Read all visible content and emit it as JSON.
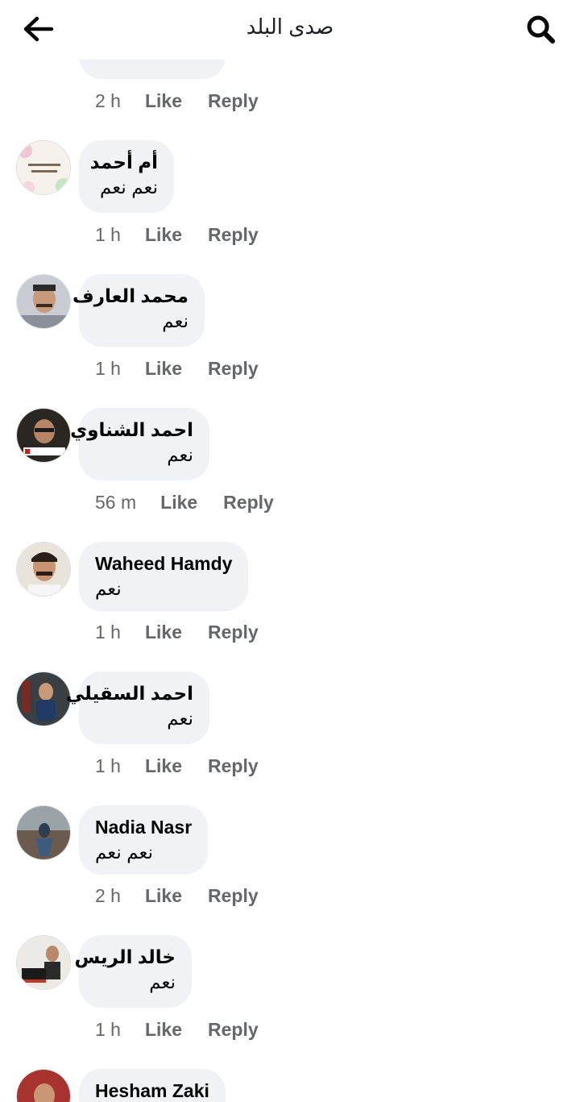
{
  "header": {
    "title": "صدى البلد",
    "back_icon": "arrow-left-icon",
    "search_icon": "search-icon"
  },
  "actions": {
    "like": "Like",
    "reply": "Reply"
  },
  "partial_top": {
    "time": "2 h"
  },
  "comments": [
    {
      "name": "أم أحمد",
      "text": "نعم نعم",
      "time": "1 h"
    },
    {
      "name": "محمد العارف",
      "text": "نعم",
      "time": "1 h"
    },
    {
      "name": "احمد الشناوي",
      "text": "نعم",
      "time": "56 m"
    },
    {
      "name": "Waheed Hamdy",
      "text": "نعم",
      "time": "1 h"
    },
    {
      "name": "احمد السقيلي",
      "text": "نعم",
      "time": "1 h"
    },
    {
      "name": "Nadia Nasr",
      "text": "نعم نعم",
      "time": "2 h"
    },
    {
      "name": "خالد الريس",
      "text": "نعم",
      "time": "1 h"
    },
    {
      "name": "Hesham Zaki",
      "text": "",
      "time": ""
    }
  ],
  "colors": {
    "bubble": "#f0f2f5",
    "meta_text": "#65676b",
    "primary_text": "#050505"
  }
}
